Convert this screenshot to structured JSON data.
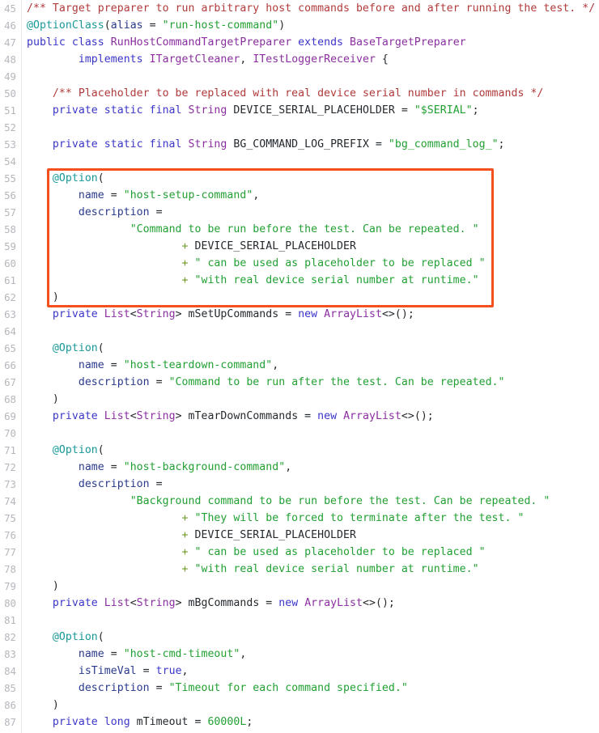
{
  "viewer": {
    "name": "code-viewer",
    "language": "java",
    "first_line_number": 45,
    "last_line_number": 87,
    "background_color": "#ffffff",
    "gutter_color": "#b6b6bd"
  },
  "annotation": {
    "type": "highlight-rectangle",
    "color": "#f4501e",
    "covers_lines": "55-62",
    "label": ""
  },
  "colors": {
    "keyword": "#3b36c8",
    "type": "#8b2fa0",
    "annotation": "#1a9898",
    "string": "#22a033",
    "comment": "#b03a3a",
    "operator": "#6f9a27",
    "plain": "#24292e",
    "highlight": "#f4501e"
  },
  "lines": [
    {
      "n": "45",
      "tokens": [
        {
          "t": "cmt",
          "v": "/** Target preparer to run arbitrary host commands before and after running the test. */"
        }
      ]
    },
    {
      "n": "46",
      "tokens": [
        {
          "t": "ann",
          "v": "@OptionClass"
        },
        {
          "t": "punct",
          "v": "("
        },
        {
          "t": "attr",
          "v": "alias"
        },
        {
          "t": "plain",
          "v": " = "
        },
        {
          "t": "str",
          "v": "\"run-host-command\""
        },
        {
          "t": "punct",
          "v": ")"
        }
      ]
    },
    {
      "n": "47",
      "tokens": [
        {
          "t": "kw",
          "v": "public class"
        },
        {
          "t": "plain",
          "v": " "
        },
        {
          "t": "cls",
          "v": "RunHostCommandTargetPreparer"
        },
        {
          "t": "plain",
          "v": " "
        },
        {
          "t": "kw",
          "v": "extends"
        },
        {
          "t": "plain",
          "v": " "
        },
        {
          "t": "cls",
          "v": "BaseTargetPreparer"
        }
      ]
    },
    {
      "n": "48",
      "tokens": [
        {
          "t": "plain",
          "v": "        "
        },
        {
          "t": "kw",
          "v": "implements"
        },
        {
          "t": "plain",
          "v": " "
        },
        {
          "t": "cls",
          "v": "ITargetCleaner"
        },
        {
          "t": "plain",
          "v": ", "
        },
        {
          "t": "cls",
          "v": "ITestLoggerReceiver"
        },
        {
          "t": "plain",
          "v": " {"
        }
      ]
    },
    {
      "n": "49",
      "tokens": []
    },
    {
      "n": "50",
      "tokens": [
        {
          "t": "plain",
          "v": "    "
        },
        {
          "t": "cmt",
          "v": "/** Placeholder to be replaced with real device serial number in commands */"
        }
      ]
    },
    {
      "n": "51",
      "tokens": [
        {
          "t": "plain",
          "v": "    "
        },
        {
          "t": "kw",
          "v": "private static final"
        },
        {
          "t": "plain",
          "v": " "
        },
        {
          "t": "type",
          "v": "String"
        },
        {
          "t": "plain",
          "v": " DEVICE_SERIAL_PLACEHOLDER = "
        },
        {
          "t": "str",
          "v": "\"$SERIAL\""
        },
        {
          "t": "plain",
          "v": ";"
        }
      ]
    },
    {
      "n": "52",
      "tokens": []
    },
    {
      "n": "53",
      "tokens": [
        {
          "t": "plain",
          "v": "    "
        },
        {
          "t": "kw",
          "v": "private static final"
        },
        {
          "t": "plain",
          "v": " "
        },
        {
          "t": "type",
          "v": "String"
        },
        {
          "t": "plain",
          "v": " BG_COMMAND_LOG_PREFIX = "
        },
        {
          "t": "str",
          "v": "\"bg_command_log_\""
        },
        {
          "t": "plain",
          "v": ";"
        }
      ]
    },
    {
      "n": "54",
      "tokens": []
    },
    {
      "n": "55",
      "tokens": [
        {
          "t": "plain",
          "v": "    "
        },
        {
          "t": "ann",
          "v": "@Option"
        },
        {
          "t": "punct",
          "v": "("
        }
      ]
    },
    {
      "n": "56",
      "tokens": [
        {
          "t": "plain",
          "v": "        "
        },
        {
          "t": "attr",
          "v": "name"
        },
        {
          "t": "plain",
          "v": " = "
        },
        {
          "t": "str",
          "v": "\"host-setup-command\""
        },
        {
          "t": "plain",
          "v": ","
        }
      ]
    },
    {
      "n": "57",
      "tokens": [
        {
          "t": "plain",
          "v": "        "
        },
        {
          "t": "attr",
          "v": "description"
        },
        {
          "t": "plain",
          "v": " ="
        }
      ]
    },
    {
      "n": "58",
      "tokens": [
        {
          "t": "plain",
          "v": "                "
        },
        {
          "t": "str",
          "v": "\"Command to be run before the test. Can be repeated. \""
        }
      ]
    },
    {
      "n": "59",
      "tokens": [
        {
          "t": "plain",
          "v": "                        "
        },
        {
          "t": "op",
          "v": "+"
        },
        {
          "t": "plain",
          "v": " DEVICE_SERIAL_PLACEHOLDER"
        }
      ]
    },
    {
      "n": "60",
      "tokens": [
        {
          "t": "plain",
          "v": "                        "
        },
        {
          "t": "op",
          "v": "+"
        },
        {
          "t": "plain",
          "v": " "
        },
        {
          "t": "str",
          "v": "\" can be used as placeholder to be replaced \""
        }
      ]
    },
    {
      "n": "61",
      "tokens": [
        {
          "t": "plain",
          "v": "                        "
        },
        {
          "t": "op",
          "v": "+"
        },
        {
          "t": "plain",
          "v": " "
        },
        {
          "t": "str",
          "v": "\"with real device serial number at runtime.\""
        }
      ]
    },
    {
      "n": "62",
      "tokens": [
        {
          "t": "plain",
          "v": "    "
        },
        {
          "t": "punct",
          "v": ")"
        }
      ]
    },
    {
      "n": "63",
      "tokens": [
        {
          "t": "plain",
          "v": "    "
        },
        {
          "t": "kw",
          "v": "private"
        },
        {
          "t": "plain",
          "v": " "
        },
        {
          "t": "type",
          "v": "List"
        },
        {
          "t": "plain",
          "v": "<"
        },
        {
          "t": "type",
          "v": "String"
        },
        {
          "t": "plain",
          "v": "> mSetUpCommands = "
        },
        {
          "t": "kw",
          "v": "new"
        },
        {
          "t": "plain",
          "v": " "
        },
        {
          "t": "type",
          "v": "ArrayList"
        },
        {
          "t": "plain",
          "v": "<>();"
        }
      ]
    },
    {
      "n": "64",
      "tokens": []
    },
    {
      "n": "65",
      "tokens": [
        {
          "t": "plain",
          "v": "    "
        },
        {
          "t": "ann",
          "v": "@Option"
        },
        {
          "t": "punct",
          "v": "("
        }
      ]
    },
    {
      "n": "66",
      "tokens": [
        {
          "t": "plain",
          "v": "        "
        },
        {
          "t": "attr",
          "v": "name"
        },
        {
          "t": "plain",
          "v": " = "
        },
        {
          "t": "str",
          "v": "\"host-teardown-command\""
        },
        {
          "t": "plain",
          "v": ","
        }
      ]
    },
    {
      "n": "67",
      "tokens": [
        {
          "t": "plain",
          "v": "        "
        },
        {
          "t": "attr",
          "v": "description"
        },
        {
          "t": "plain",
          "v": " = "
        },
        {
          "t": "str",
          "v": "\"Command to be run after the test. Can be repeated.\""
        }
      ]
    },
    {
      "n": "68",
      "tokens": [
        {
          "t": "plain",
          "v": "    "
        },
        {
          "t": "punct",
          "v": ")"
        }
      ]
    },
    {
      "n": "69",
      "tokens": [
        {
          "t": "plain",
          "v": "    "
        },
        {
          "t": "kw",
          "v": "private"
        },
        {
          "t": "plain",
          "v": " "
        },
        {
          "t": "type",
          "v": "List"
        },
        {
          "t": "plain",
          "v": "<"
        },
        {
          "t": "type",
          "v": "String"
        },
        {
          "t": "plain",
          "v": "> mTearDownCommands = "
        },
        {
          "t": "kw",
          "v": "new"
        },
        {
          "t": "plain",
          "v": " "
        },
        {
          "t": "type",
          "v": "ArrayList"
        },
        {
          "t": "plain",
          "v": "<>();"
        }
      ]
    },
    {
      "n": "70",
      "tokens": []
    },
    {
      "n": "71",
      "tokens": [
        {
          "t": "plain",
          "v": "    "
        },
        {
          "t": "ann",
          "v": "@Option"
        },
        {
          "t": "punct",
          "v": "("
        }
      ]
    },
    {
      "n": "72",
      "tokens": [
        {
          "t": "plain",
          "v": "        "
        },
        {
          "t": "attr",
          "v": "name"
        },
        {
          "t": "plain",
          "v": " = "
        },
        {
          "t": "str",
          "v": "\"host-background-command\""
        },
        {
          "t": "plain",
          "v": ","
        }
      ]
    },
    {
      "n": "73",
      "tokens": [
        {
          "t": "plain",
          "v": "        "
        },
        {
          "t": "attr",
          "v": "description"
        },
        {
          "t": "plain",
          "v": " ="
        }
      ]
    },
    {
      "n": "74",
      "tokens": [
        {
          "t": "plain",
          "v": "                "
        },
        {
          "t": "str",
          "v": "\"Background command to be run before the test. Can be repeated. \""
        }
      ]
    },
    {
      "n": "75",
      "tokens": [
        {
          "t": "plain",
          "v": "                        "
        },
        {
          "t": "op",
          "v": "+"
        },
        {
          "t": "plain",
          "v": " "
        },
        {
          "t": "str",
          "v": "\"They will be forced to terminate after the test. \""
        }
      ]
    },
    {
      "n": "76",
      "tokens": [
        {
          "t": "plain",
          "v": "                        "
        },
        {
          "t": "op",
          "v": "+"
        },
        {
          "t": "plain",
          "v": " DEVICE_SERIAL_PLACEHOLDER"
        }
      ]
    },
    {
      "n": "77",
      "tokens": [
        {
          "t": "plain",
          "v": "                        "
        },
        {
          "t": "op",
          "v": "+"
        },
        {
          "t": "plain",
          "v": " "
        },
        {
          "t": "str",
          "v": "\" can be used as placeholder to be replaced \""
        }
      ]
    },
    {
      "n": "78",
      "tokens": [
        {
          "t": "plain",
          "v": "                        "
        },
        {
          "t": "op",
          "v": "+"
        },
        {
          "t": "plain",
          "v": " "
        },
        {
          "t": "str",
          "v": "\"with real device serial number at runtime.\""
        }
      ]
    },
    {
      "n": "79",
      "tokens": [
        {
          "t": "plain",
          "v": "    "
        },
        {
          "t": "punct",
          "v": ")"
        }
      ]
    },
    {
      "n": "80",
      "tokens": [
        {
          "t": "plain",
          "v": "    "
        },
        {
          "t": "kw",
          "v": "private"
        },
        {
          "t": "plain",
          "v": " "
        },
        {
          "t": "type",
          "v": "List"
        },
        {
          "t": "plain",
          "v": "<"
        },
        {
          "t": "type",
          "v": "String"
        },
        {
          "t": "plain",
          "v": "> mBgCommands = "
        },
        {
          "t": "kw",
          "v": "new"
        },
        {
          "t": "plain",
          "v": " "
        },
        {
          "t": "type",
          "v": "ArrayList"
        },
        {
          "t": "plain",
          "v": "<>();"
        }
      ]
    },
    {
      "n": "81",
      "tokens": []
    },
    {
      "n": "82",
      "tokens": [
        {
          "t": "plain",
          "v": "    "
        },
        {
          "t": "ann",
          "v": "@Option"
        },
        {
          "t": "punct",
          "v": "("
        }
      ]
    },
    {
      "n": "83",
      "tokens": [
        {
          "t": "plain",
          "v": "        "
        },
        {
          "t": "attr",
          "v": "name"
        },
        {
          "t": "plain",
          "v": " = "
        },
        {
          "t": "str",
          "v": "\"host-cmd-timeout\""
        },
        {
          "t": "plain",
          "v": ","
        }
      ]
    },
    {
      "n": "84",
      "tokens": [
        {
          "t": "plain",
          "v": "        "
        },
        {
          "t": "attr",
          "v": "isTimeVal"
        },
        {
          "t": "plain",
          "v": " = "
        },
        {
          "t": "kw",
          "v": "true"
        },
        {
          "t": "plain",
          "v": ","
        }
      ]
    },
    {
      "n": "85",
      "tokens": [
        {
          "t": "plain",
          "v": "        "
        },
        {
          "t": "attr",
          "v": "description"
        },
        {
          "t": "plain",
          "v": " = "
        },
        {
          "t": "str",
          "v": "\"Timeout for each command specified.\""
        }
      ]
    },
    {
      "n": "86",
      "tokens": [
        {
          "t": "plain",
          "v": "    "
        },
        {
          "t": "punct",
          "v": ")"
        }
      ]
    },
    {
      "n": "87",
      "tokens": [
        {
          "t": "plain",
          "v": "    "
        },
        {
          "t": "kw",
          "v": "private long"
        },
        {
          "t": "plain",
          "v": " mTimeout = "
        },
        {
          "t": "num",
          "v": "60000L"
        },
        {
          "t": "plain",
          "v": ";"
        }
      ]
    }
  ]
}
